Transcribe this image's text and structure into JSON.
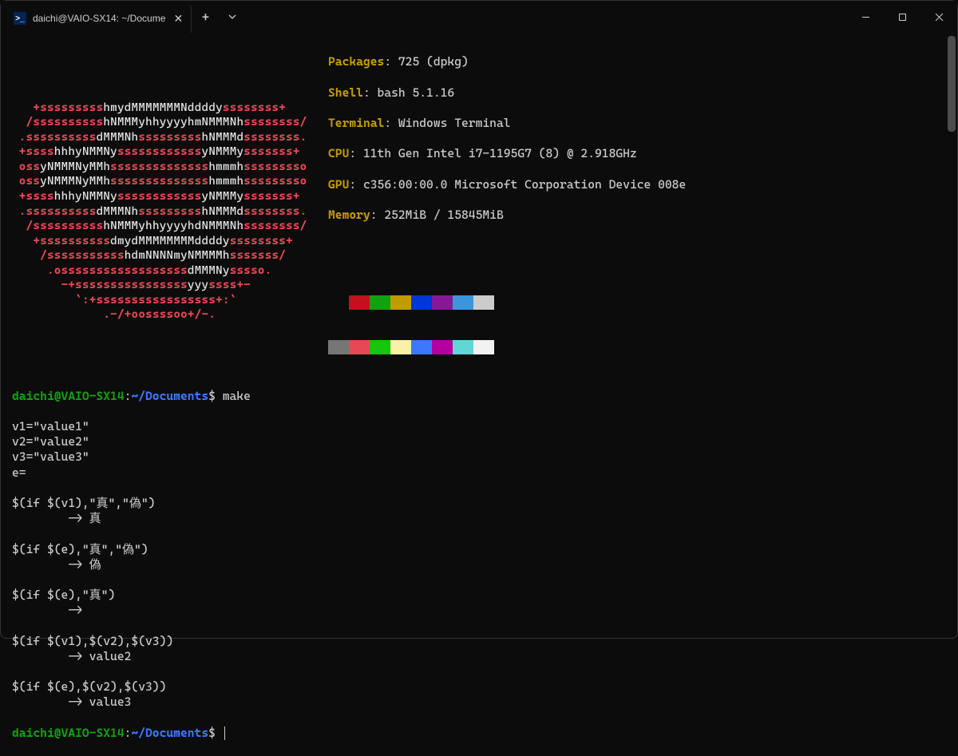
{
  "titlebar": {
    "tab_title": "daichi@VAIO-SX14: ~/Docume",
    "tab_icon_glyph": ">_"
  },
  "ascii_logo": [
    "   +ssssssssshmydMMMMMMMNddddyssssssss+",
    "  /sssssssssshNMMMyhhyyyyhmNMMMNhssssssss/",
    " .ssssssssssdMMMNhssssssssshNMMMdssssssss.",
    " +sssshhhyNMMNyssssssssssssyNMMMysssssss+",
    " ossyNMMMNyMMhsssssssssssssshmmmhsssssssso",
    " ossyNMMMNyMMhsssssssssssssshmmmhsssssssso",
    " +sssshhhyNMMNyssssssssssssyNMMMysssssss+",
    " .ssssssssssdMMMNhssssssssshNMMMdssssssss.",
    "  /sssssssssshNMMMyhhyyyyhdNMMMNhssssssss/",
    "   +ssssssssssdmydMMMMMMMMddddyssssssss+",
    "    /ssssssssssshdmNNNNmyNMMMMhsssssss/",
    "     .ossssssssssssssssssdMMMNysssso.",
    "       -+ssssssssssssssssyyyssss+-",
    "         `:+sssssssssssssssss+:`",
    "             .-/+oossssoo+/-."
  ],
  "sysinfo": {
    "packages_label": "Packages",
    "packages_value": ": 725 (dpkg)",
    "shell_label": "Shell",
    "shell_value": ": bash 5.1.16",
    "terminal_label": "Terminal",
    "terminal_value": ": Windows Terminal",
    "cpu_label": "CPU",
    "cpu_value": ": 11th Gen Intel i7-1195G7 (8) @ 2.918GHz",
    "gpu_label": "GPU",
    "gpu_value": ": c356:00:00.0 Microsoft Corporation Device 008e",
    "memory_label": "Memory",
    "memory_value": ": 252MiB / 15845MiB"
  },
  "palette_dark": [
    "#0c0c0c",
    "#c50f1f",
    "#13a10e",
    "#c19c00",
    "#0037da",
    "#881798",
    "#3a96dd",
    "#cccccc"
  ],
  "palette_light": [
    "#767676",
    "#e74856",
    "#16c60c",
    "#f9f1a5",
    "#3b78ff",
    "#b4009e",
    "#61d6d6",
    "#f2f2f2"
  ],
  "prompt": {
    "user": "daichi",
    "at": "@",
    "host": "VAIO-SX14",
    "colon": ":",
    "path": "~/Documents",
    "dollar": "$ "
  },
  "cmd1": "make",
  "output": [
    "v1=\"value1\"",
    "v2=\"value2\"",
    "v3=\"value3\"",
    "e=",
    "",
    "$(if $(v1),\"真\",\"偽\")",
    "        -> 真",
    "",
    "$(if $(e),\"真\",\"偽\")",
    "        -> 偽",
    "",
    "$(if $(e),\"真\")",
    "        ->",
    "",
    "$(if $(v1),$(v2),$(v3))",
    "        -> value2",
    "",
    "$(if $(e),$(v2),$(v3))",
    "        -> value3",
    ""
  ]
}
